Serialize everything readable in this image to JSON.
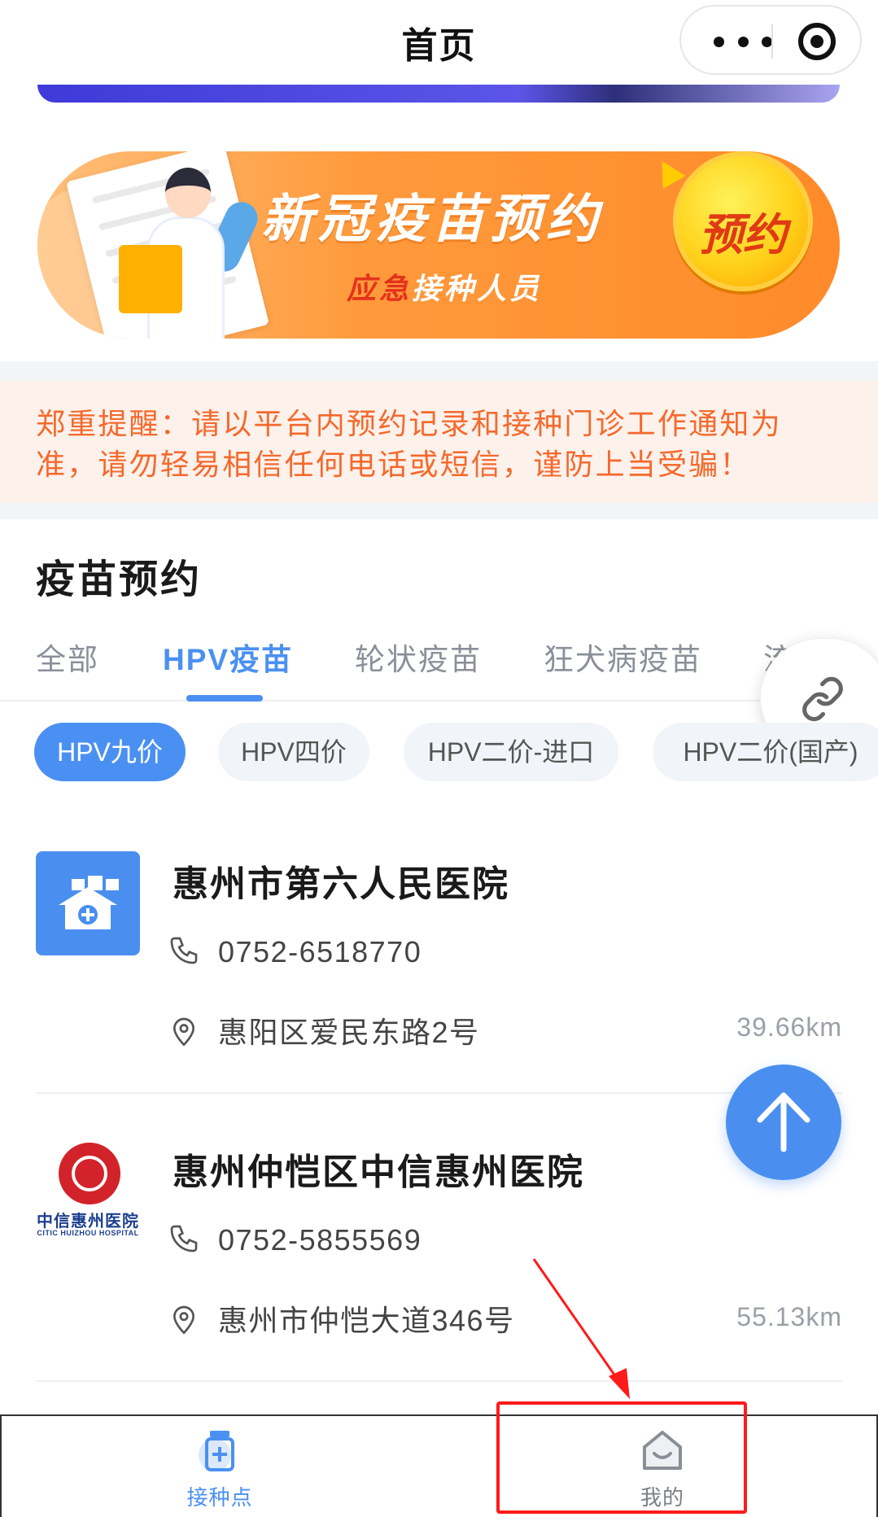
{
  "nav": {
    "title": "首页"
  },
  "banner": {
    "title": "新冠疫苗预约",
    "subtitle_highlight": "应急",
    "subtitle_rest": "接种人员",
    "badge": "预约"
  },
  "warning": {
    "text": "郑重提醒：请以平台内预约记录和接种门诊工作通知为准，请勿轻易相信任何电话或短信，谨防上当受骗！"
  },
  "section": {
    "title": "疫苗预约"
  },
  "tabs": [
    {
      "label": "全部"
    },
    {
      "label": "HPV疫苗"
    },
    {
      "label": "轮状疫苗"
    },
    {
      "label": "狂犬病疫苗"
    },
    {
      "label": "流"
    }
  ],
  "chips": [
    {
      "label": "HPV九价"
    },
    {
      "label": "HPV四价"
    },
    {
      "label": "HPV二价-进口"
    },
    {
      "label": "HPV二价(国产)"
    }
  ],
  "hospitals": [
    {
      "name": "惠州市第六人民医院",
      "phone": "0752-6518770",
      "address": "惠阳区爱民东路2号",
      "distance": "39.66km"
    },
    {
      "name": "惠州仲恺区中信惠州医院",
      "phone": "0752-5855569",
      "address": "惠州市仲恺大道346号",
      "distance": "55.13km",
      "logo_cn": "中信惠州医院",
      "logo_en": "CITIC HUIZHOU HOSPITAL"
    }
  ],
  "tabbar": [
    {
      "label": "接种点",
      "icon": "vaccine-bottle-icon",
      "active": true
    },
    {
      "label": "我的",
      "icon": "smile-house-icon",
      "active": false
    }
  ],
  "colors": {
    "accent": "#4a90f2",
    "warning": "#f5692b",
    "annotation": "#ff1a1a"
  }
}
